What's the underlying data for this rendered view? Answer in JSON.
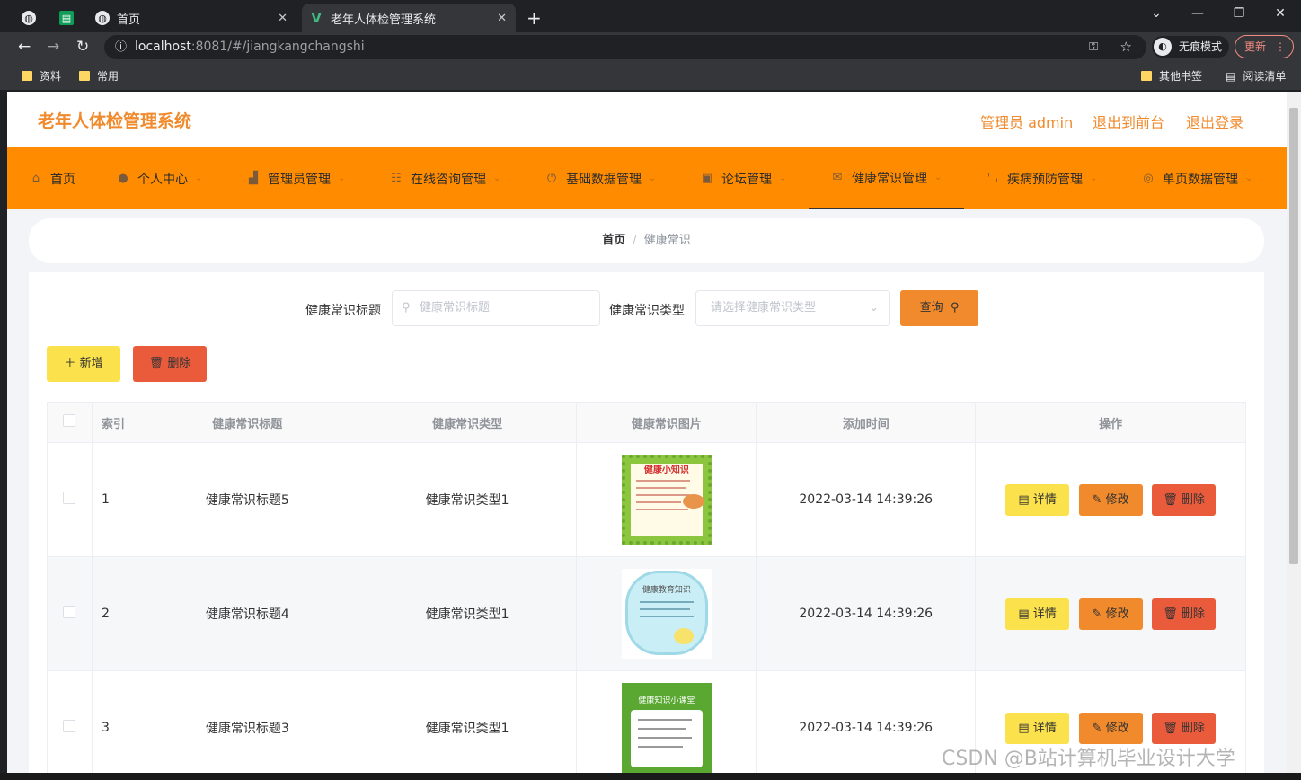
{
  "browser": {
    "tabs": [
      {
        "title": ""
      },
      {
        "title": ""
      },
      {
        "title": "首页"
      },
      {
        "title": "老年人体检管理系统"
      }
    ],
    "url_host": "localhost",
    "url_path": ":8081/#/jiangkangchangshi",
    "incognito_label": "无痕模式",
    "update_label": "更新",
    "bookmarks": [
      "资料",
      "常用"
    ],
    "bookmarks_right": [
      "其他书签",
      "阅读清单"
    ]
  },
  "header": {
    "brand": "老年人体检管理系统",
    "user": "管理员 admin",
    "to_front": "退出到前台",
    "logout": "退出登录"
  },
  "menu": [
    {
      "label": "首页",
      "icon": "home-icon"
    },
    {
      "label": "个人中心",
      "icon": "user-icon"
    },
    {
      "label": "管理员管理",
      "icon": "building-icon"
    },
    {
      "label": "在线咨询管理",
      "icon": "list-icon"
    },
    {
      "label": "基础数据管理",
      "icon": "power-icon"
    },
    {
      "label": "论坛管理",
      "icon": "clipboard-icon"
    },
    {
      "label": "健康常识管理",
      "icon": "mail-icon"
    },
    {
      "label": "疾病预防管理",
      "icon": "frame-icon"
    },
    {
      "label": "单页数据管理",
      "icon": "target-icon"
    }
  ],
  "breadcrumb": {
    "home": "首页",
    "current": "健康常识"
  },
  "search": {
    "title_label": "健康常识标题",
    "title_placeholder": "健康常识标题",
    "type_label": "健康常识类型",
    "type_placeholder": "请选择健康常识类型",
    "query_button": "查询"
  },
  "actions": {
    "add": "新增",
    "delete": "删除"
  },
  "table": {
    "columns": [
      "索引",
      "健康常识标题",
      "健康常识类型",
      "健康常识图片",
      "添加时间",
      "操作"
    ],
    "rows": [
      {
        "index": "1",
        "title": "健康常识标题5",
        "type": "健康常识类型1",
        "image_text": "健康小知识",
        "time": "2022-03-14 14:39:26"
      },
      {
        "index": "2",
        "title": "健康常识标题4",
        "type": "健康常识类型1",
        "image_text": "健康教育知识",
        "time": "2022-03-14 14:39:26"
      },
      {
        "index": "3",
        "title": "健康常识标题3",
        "type": "健康常识类型1",
        "image_text": "健康知识小课堂",
        "time": "2022-03-14 14:39:26"
      }
    ],
    "row_buttons": {
      "detail": "详情",
      "edit": "修改",
      "delete": "删除"
    }
  },
  "watermark": "CSDN @B站计算机毕业设计大学",
  "colors": {
    "accent": "#ff8c00",
    "brand_text": "#f08a2c",
    "detail_btn": "#fbe14b",
    "edit_btn": "#f08a2c",
    "delete_btn": "#ea5b3c"
  }
}
